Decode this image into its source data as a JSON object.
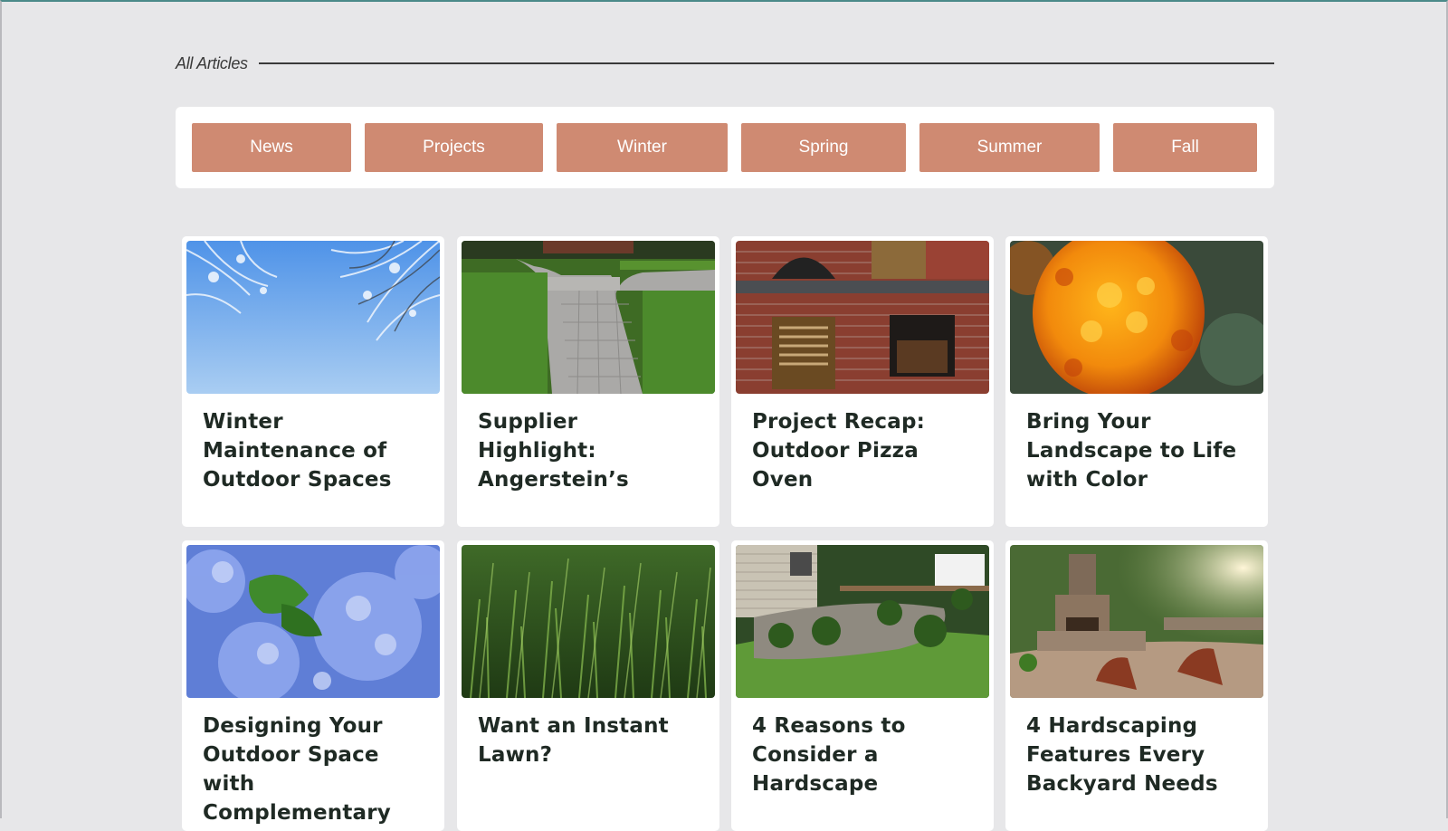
{
  "section": {
    "title": "All Articles"
  },
  "filters": [
    {
      "label": "News"
    },
    {
      "label": "Projects"
    },
    {
      "label": "Winter"
    },
    {
      "label": "Spring"
    },
    {
      "label": "Summer"
    },
    {
      "label": "Fall"
    }
  ],
  "colors": {
    "accent": "#cf8a72",
    "background": "#e7e7e9",
    "title": "#1f2a24"
  },
  "articles": [
    {
      "title": "Winter Maintenance of Outdoor Spaces",
      "image": "frosted-tree-branches-sky"
    },
    {
      "title": "Supplier Highlight: Angerstein’s",
      "image": "paver-walkway-lawn"
    },
    {
      "title": "Project Recap: Outdoor Pizza Oven",
      "image": "brick-pizza-oven"
    },
    {
      "title": "Bring Your Landscape to Life with Color",
      "image": "orange-marigold"
    },
    {
      "title": "Designing Your Outdoor Space with Complementary Colors",
      "image": "blue-hydrangeas"
    },
    {
      "title": "Want an Instant Lawn?",
      "image": "green-grass-closeup"
    },
    {
      "title": "4 Reasons to Consider a Hardscape",
      "image": "backyard-patio-garden"
    },
    {
      "title": "4 Hardscaping Features Every Backyard Needs",
      "image": "stone-fireplace-patio"
    }
  ]
}
